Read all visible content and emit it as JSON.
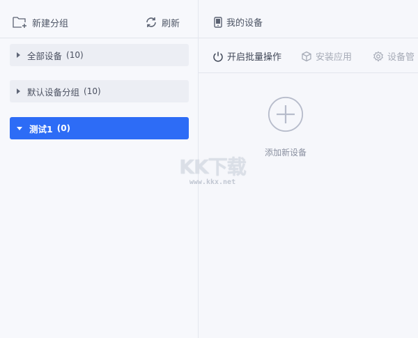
{
  "sidebar": {
    "toolbar": {
      "new_group_label": "新建分组",
      "refresh_label": "刷新"
    },
    "groups": [
      {
        "name": "全部设备",
        "count": "(10)",
        "expanded": false
      },
      {
        "name": "默认设备分组",
        "count": "(10)",
        "expanded": false
      },
      {
        "name": "测试1",
        "count": "(0)",
        "expanded": true,
        "selected": true
      }
    ]
  },
  "main": {
    "header_title": "我的设备",
    "actions": [
      {
        "label": "开启批量操作",
        "icon": "power-icon",
        "enabled": true
      },
      {
        "label": "安装应用",
        "icon": "cube-icon",
        "enabled": false
      },
      {
        "label": "设备管",
        "icon": "gear-icon",
        "enabled": false
      }
    ],
    "add_device_label": "添加新设备"
  },
  "watermark": {
    "logo_text": "KK下载",
    "url": "www.kkx.net"
  },
  "colors": {
    "accent": "#2d6cf6",
    "group_bg": "#eceef4",
    "background": "#f6f7fb",
    "disabled_text": "#a6abb7"
  }
}
